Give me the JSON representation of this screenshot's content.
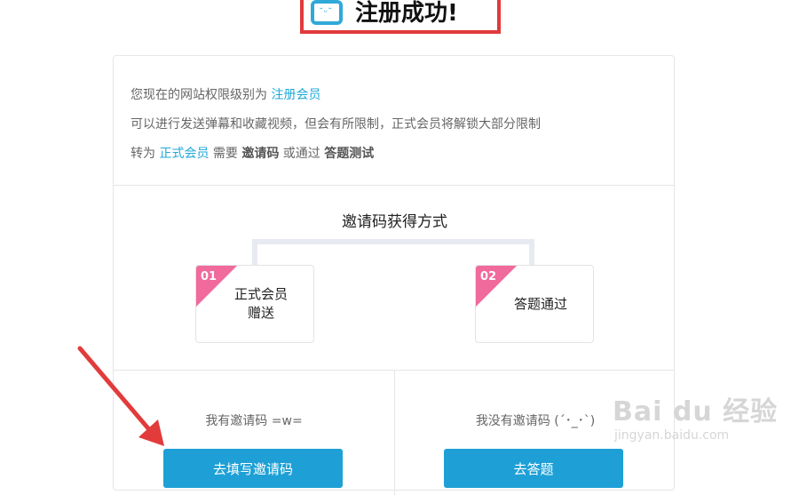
{
  "header": {
    "title": "注册成功!",
    "logo_icon": "tv-face-icon"
  },
  "info": {
    "line1_prefix": "您现在的网站权限级别为 ",
    "line1_link": "注册会员",
    "line2": "可以进行发送弹幕和收藏视频，但会有所限制，正式会员将解锁大部分限制",
    "line3_prefix": "转为 ",
    "line3_link": "正式会员",
    "line3_mid1": " 需要 ",
    "line3_bold1": "邀请码",
    "line3_mid2": " 或通过 ",
    "line3_bold2": "答题测试"
  },
  "methods": {
    "title": "邀请码获得方式",
    "items": [
      {
        "number": "01",
        "label_line1": "正式会员",
        "label_line2": "赠送"
      },
      {
        "number": "02",
        "label_line1": "答题通过",
        "label_line2": ""
      }
    ]
  },
  "options": {
    "left": {
      "text": "我有邀请码 =w=",
      "button": "去填写邀请码"
    },
    "right": {
      "text": "我没有邀请码 (´･_･`)",
      "button": "去答题"
    }
  },
  "watermark": {
    "main": "Bai du 经验",
    "sub": "jingyan.baidu.com"
  },
  "colors": {
    "accent": "#1ea0d6",
    "link": "#1fa8d8",
    "highlight_box": "#e03a3a",
    "badge": "#f06a9b",
    "arrow": "#e23b3b"
  }
}
